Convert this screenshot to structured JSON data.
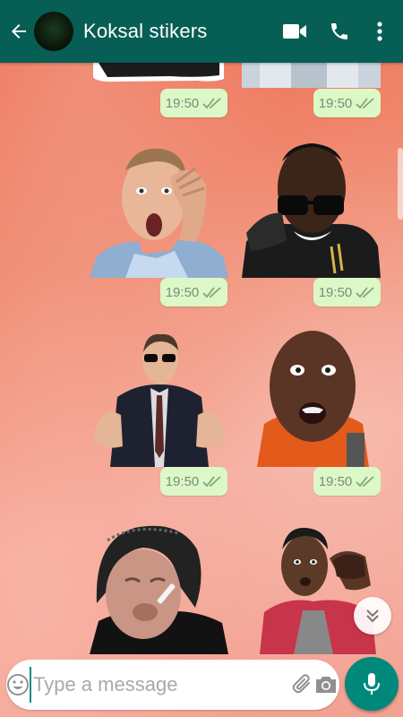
{
  "header": {
    "title": "Koksal stikers",
    "background_color": "#075e54"
  },
  "messages": [
    {
      "sticker": "cropped-sticker-left",
      "time": "19:50",
      "status": "read-double-tick"
    },
    {
      "sticker": "cropped-sticker-right",
      "time": "19:50",
      "status": "read-double-tick"
    },
    {
      "sticker": "surprised-man-hand-on-head",
      "time": "19:50",
      "status": "read-double-tick"
    },
    {
      "sticker": "man-in-sunglasses-leather-jacket",
      "time": "19:50",
      "status": "read-double-tick"
    },
    {
      "sticker": "man-in-suit-sunglasses-gesturing",
      "time": "19:50",
      "status": "read-double-tick"
    },
    {
      "sticker": "bald-man-open-mouth-orange-shirt",
      "time": "19:50",
      "status": "read-double-tick"
    },
    {
      "sticker": "old-woman-with-cigarette",
      "time": "",
      "status": ""
    },
    {
      "sticker": "young-man-with-empty-wallet",
      "time": "",
      "status": ""
    }
  ],
  "composer": {
    "placeholder": "Type a message"
  },
  "colors": {
    "bubble": "#dcf8c6",
    "tick": "#7fa67f",
    "mic_button": "#00897b"
  },
  "icons": [
    "back-arrow-icon",
    "video-call-icon",
    "phone-icon",
    "more-vert-icon",
    "emoji-icon",
    "attach-icon",
    "camera-icon",
    "mic-icon",
    "double-chevron-down-icon"
  ]
}
